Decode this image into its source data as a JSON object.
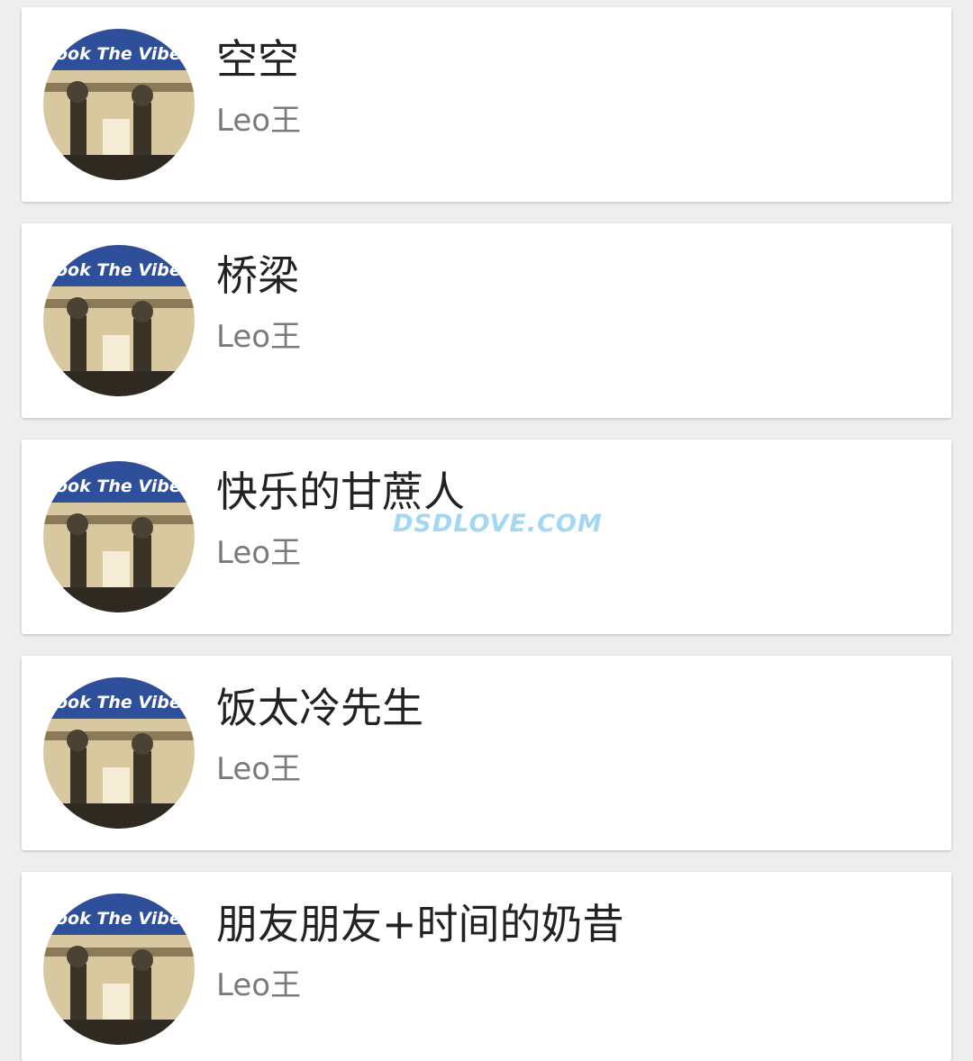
{
  "songs": [
    {
      "title": "空空",
      "artist": "Leo王"
    },
    {
      "title": "桥梁",
      "artist": "Leo王"
    },
    {
      "title": "快乐的甘蔗人",
      "artist": "Leo王"
    },
    {
      "title": "饭太冷先生",
      "artist": "Leo王"
    },
    {
      "title": "朋友朋友+时间的奶昔",
      "artist": "Leo王"
    }
  ],
  "album_art": {
    "text": "ook The Vibe"
  },
  "watermark": {
    "text": "DSDLOVE.COM"
  },
  "colors": {
    "banner": "#2e4f9a",
    "sepia": "#d8c8a0",
    "title": "#222222",
    "artist": "#7a7a7a",
    "watermark": "#9ed6f2"
  }
}
